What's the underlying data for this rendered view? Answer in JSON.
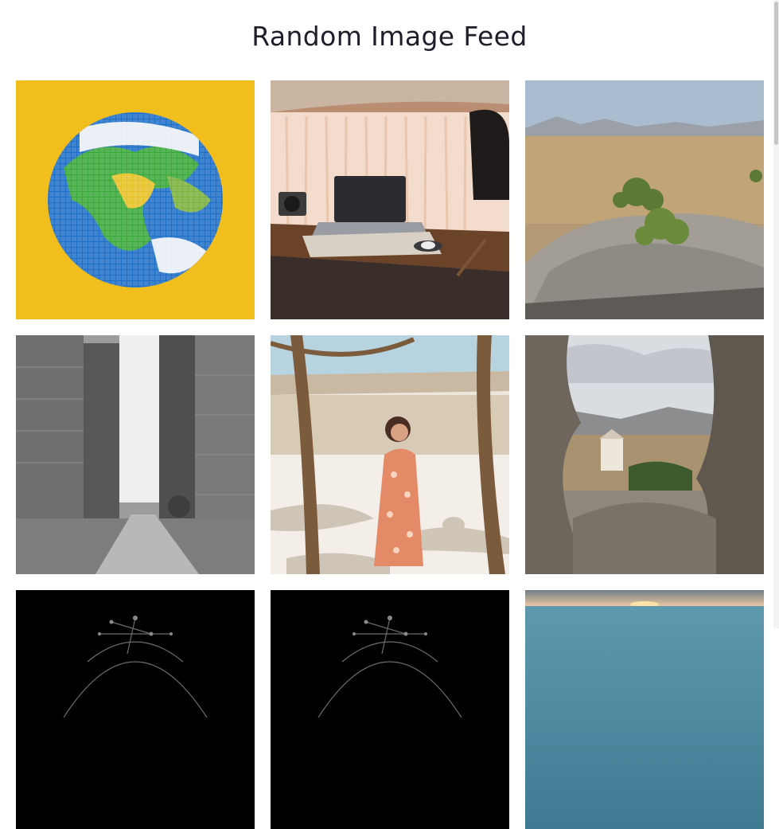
{
  "page": {
    "title": "Random Image Feed"
  },
  "feed": {
    "items": [
      {
        "subject": "globe-voxel-on-yellow",
        "background": "#F2BE1E"
      },
      {
        "subject": "laptop-desk-van-interior",
        "background": "#C8A68A"
      },
      {
        "subject": "rocky-hilltop-desert-landscape",
        "background": "#B59A74"
      },
      {
        "subject": "blurred-city-street-bw",
        "background": "#8E8E8E"
      },
      {
        "subject": "woman-in-floral-dress-desert",
        "background": "#EDE6DC"
      },
      {
        "subject": "castle-view-through-rocks",
        "background": "#8C8378"
      },
      {
        "subject": "dark-network-sphere",
        "background": "#000000"
      },
      {
        "subject": "dark-network-sphere",
        "background": "#000000"
      },
      {
        "subject": "sea-sunset",
        "background": "#4F8EA6"
      }
    ]
  }
}
